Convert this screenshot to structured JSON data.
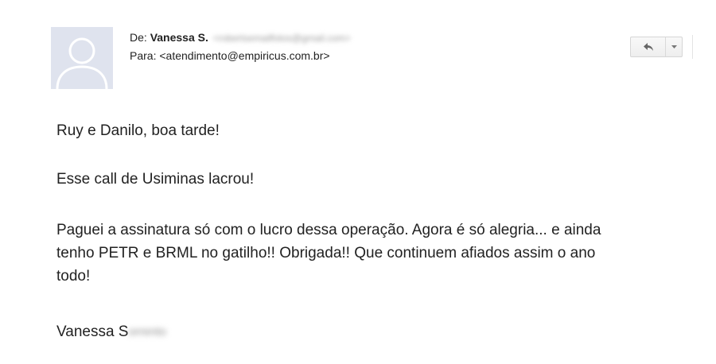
{
  "header": {
    "from_label": "De:",
    "from_name": "Vanessa S.",
    "from_email_blurred": "<robertsemailfotos@gmail.com>",
    "to_label": "Para:",
    "to_value": "<atendimento@empiricus.com.br>"
  },
  "toolbar": {
    "reply_icon": "reply-arrow-icon",
    "more_icon": "caret-down-icon"
  },
  "avatar": {
    "icon": "default-profile-silhouette",
    "bg_color": "#dfe3ee",
    "fg_color": "#ffffff"
  },
  "message": {
    "greeting": "Ruy e Danilo, boa tarde!",
    "line2": "Esse call de Usiminas lacrou!",
    "line3": "Paguei a assinatura só com o lucro dessa operação. Agora é só alegria... e ainda tenho PETR e BRML no gatilho!! Obrigada!! Que continuem afiados assim o ano todo!",
    "signature_visible": "Vanessa S",
    "signature_blurred": "orrento"
  }
}
